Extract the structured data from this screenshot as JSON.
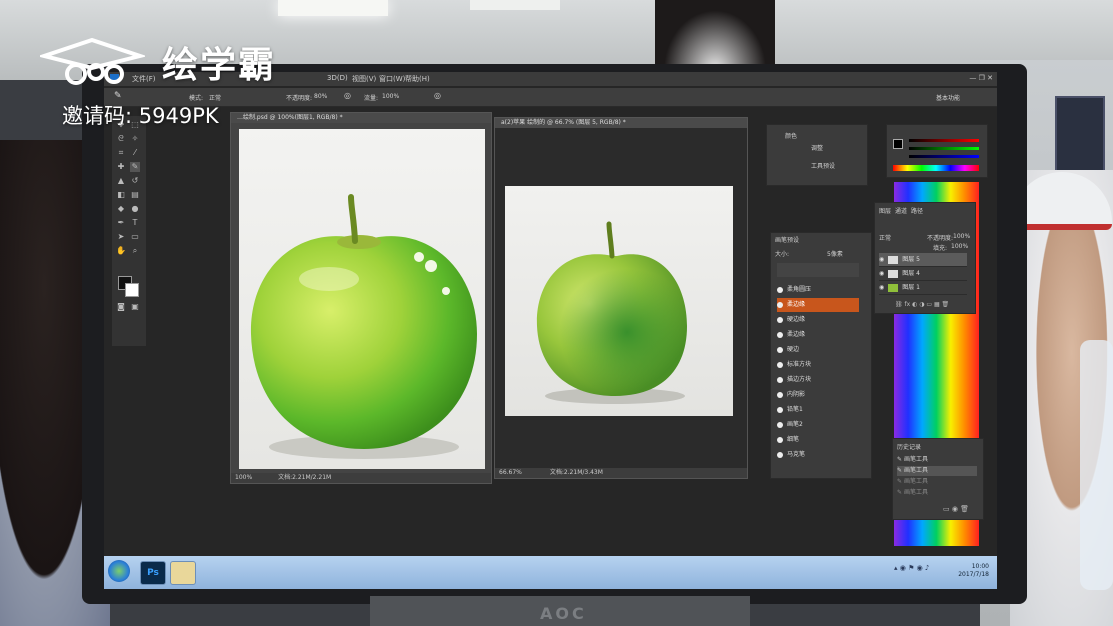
{
  "watermark": {
    "brand": "绘学霸",
    "invite_code": "邀请码: 5949PK"
  },
  "photoshop": {
    "menu": [
      "文件(F)",
      "3D(D)",
      "视图(V)",
      "窗口(W)",
      "帮助(H)"
    ],
    "options": {
      "mode_label": "模式:",
      "mode_value": "正常",
      "opacity_label": "不透明度:",
      "opacity_value": "80%",
      "flow_label": "流量:",
      "flow_value": "100%"
    },
    "workspace": "基本功能",
    "doc1": {
      "tab": "…绘制.psd @ 100%(图层1, RGB/8) *",
      "zoom": "100%",
      "doc_size": "文档:2.21M/2.21M"
    },
    "doc2": {
      "tab": "a(2)苹果 绘制的 @ 66.7% (图层 5, RGB/8) *",
      "zoom": "66.67%",
      "doc_size": "文档:2.21M/3.43M"
    },
    "side_panel": {
      "items": [
        "颜色",
        "调整",
        "工具预设"
      ]
    },
    "brush_presets": {
      "title": "画笔预设",
      "size_label": "大小:",
      "size_value": "5像素",
      "brushes": [
        {
          "label": "柔角圆压",
          "selected": false
        },
        {
          "label": "柔边缘",
          "selected": true
        },
        {
          "label": "硬边缘",
          "selected": false
        },
        {
          "label": "柔边缘",
          "selected": false
        },
        {
          "label": "硬边",
          "selected": false
        },
        {
          "label": "标准方块",
          "selected": false
        },
        {
          "label": "描边方块",
          "selected": false
        },
        {
          "label": "内阴影",
          "selected": false
        },
        {
          "label": "铅笔1",
          "selected": false
        },
        {
          "label": "画笔2",
          "selected": false
        },
        {
          "label": "细笔",
          "selected": false
        },
        {
          "label": "马克笔",
          "selected": false
        }
      ]
    },
    "layers": {
      "tabs": [
        "图层",
        "通道",
        "路径"
      ],
      "blend_mode": "正常",
      "opacity_label": "不透明度:",
      "opacity_value": "100%",
      "fill_label": "填充:",
      "fill_value": "100%",
      "rows": [
        {
          "label": "图层 5",
          "selected": true
        },
        {
          "label": "图层 4",
          "selected": false
        },
        {
          "label": "图层 1",
          "selected": false
        }
      ]
    },
    "history": {
      "title": "历史记录",
      "items": [
        "画笔工具",
        "画笔工具",
        "画笔工具",
        "画笔工具"
      ]
    },
    "taskbar": {
      "ps_label": "Ps",
      "time": "10:00",
      "date": "2017/7/18"
    }
  },
  "monitor_brand": "AOC"
}
